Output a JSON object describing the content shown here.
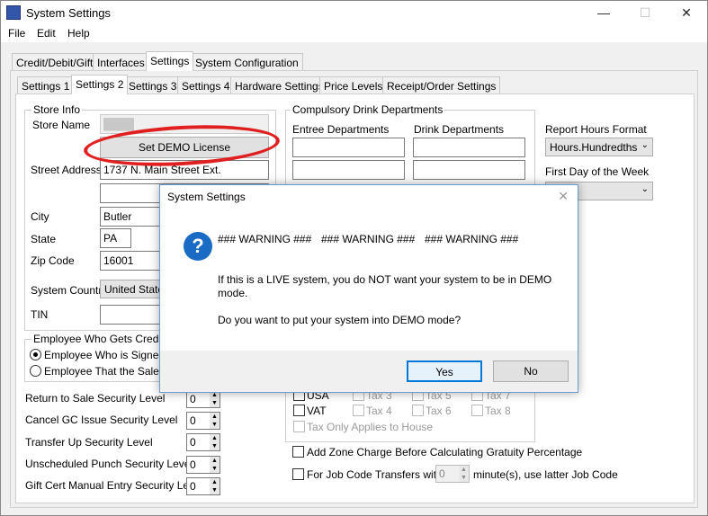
{
  "window": {
    "title": "System Settings"
  },
  "menu": [
    "File",
    "Edit",
    "Help"
  ],
  "top_tabs": [
    "Credit/Debit/Gift",
    "Interfaces",
    "Settings",
    "System Configuration"
  ],
  "sub_tabs": [
    "Settings 1",
    "Settings 2",
    "Settings 3",
    "Settings 4",
    "Hardware Settings",
    "Price Levels",
    "Receipt/Order Settings"
  ],
  "store_info": {
    "group_title": "Store Info",
    "store_name_label": "Store Name",
    "demo_button": "Set DEMO License",
    "street_label": "Street Address",
    "street_value": "1737 N. Main Street Ext.",
    "city_label": "City",
    "city_value": "Butler",
    "state_label": "State",
    "state_value": "PA",
    "zip_label": "Zip Code",
    "zip_value": "16001",
    "country_label": "System Country",
    "country_value": "United States",
    "tin_label": "TIN"
  },
  "employee_credit": {
    "group_title": "Employee Who Gets Credit fo",
    "opt1": "Employee Who is Signed C",
    "opt2": "Employee That the Sale is"
  },
  "security": [
    {
      "label": "Return to Sale Security Level",
      "value": "0"
    },
    {
      "label": "Cancel GC Issue Security Level",
      "value": "0"
    },
    {
      "label": "Transfer Up Security Level",
      "value": "0"
    },
    {
      "label": "Unscheduled Punch Security Level",
      "value": "0"
    },
    {
      "label": "Gift Cert Manual Entry Security Level",
      "value": "0"
    }
  ],
  "drink": {
    "group_title": "Compulsory Drink Departments",
    "entree_label": "Entree Departments",
    "drink_label": "Drink Departments"
  },
  "report": {
    "hours_label": "Report Hours Format",
    "hours_value": "Hours.Hundredths",
    "first_day_label": "First Day of the Week"
  },
  "tax": {
    "usa": "USA",
    "vat": "VAT",
    "tax3": "Tax 3",
    "tax4": "Tax 4",
    "tax5": "Tax 5",
    "tax6": "Tax 6",
    "tax7": "Tax 7",
    "tax8": "Tax 8",
    "house": "Tax Only Applies to House"
  },
  "options": {
    "zone_charge": "Add Zone Charge Before Calculating Gratuity Percentage",
    "job_code_pre": "For Job Code Transfers within",
    "job_code_value": "0",
    "job_code_post": "minute(s), use latter Job Code"
  },
  "dialog": {
    "title": "System Settings",
    "warning1": "### WARNING ###",
    "warning2": "### WARNING ###",
    "warning3": "### WARNING ###",
    "line1": "If this is a LIVE system, you do NOT want your system to be in DEMO",
    "line2": "mode.",
    "question": "Do you want to put your system into DEMO mode?",
    "yes": "Yes",
    "no": "No"
  }
}
